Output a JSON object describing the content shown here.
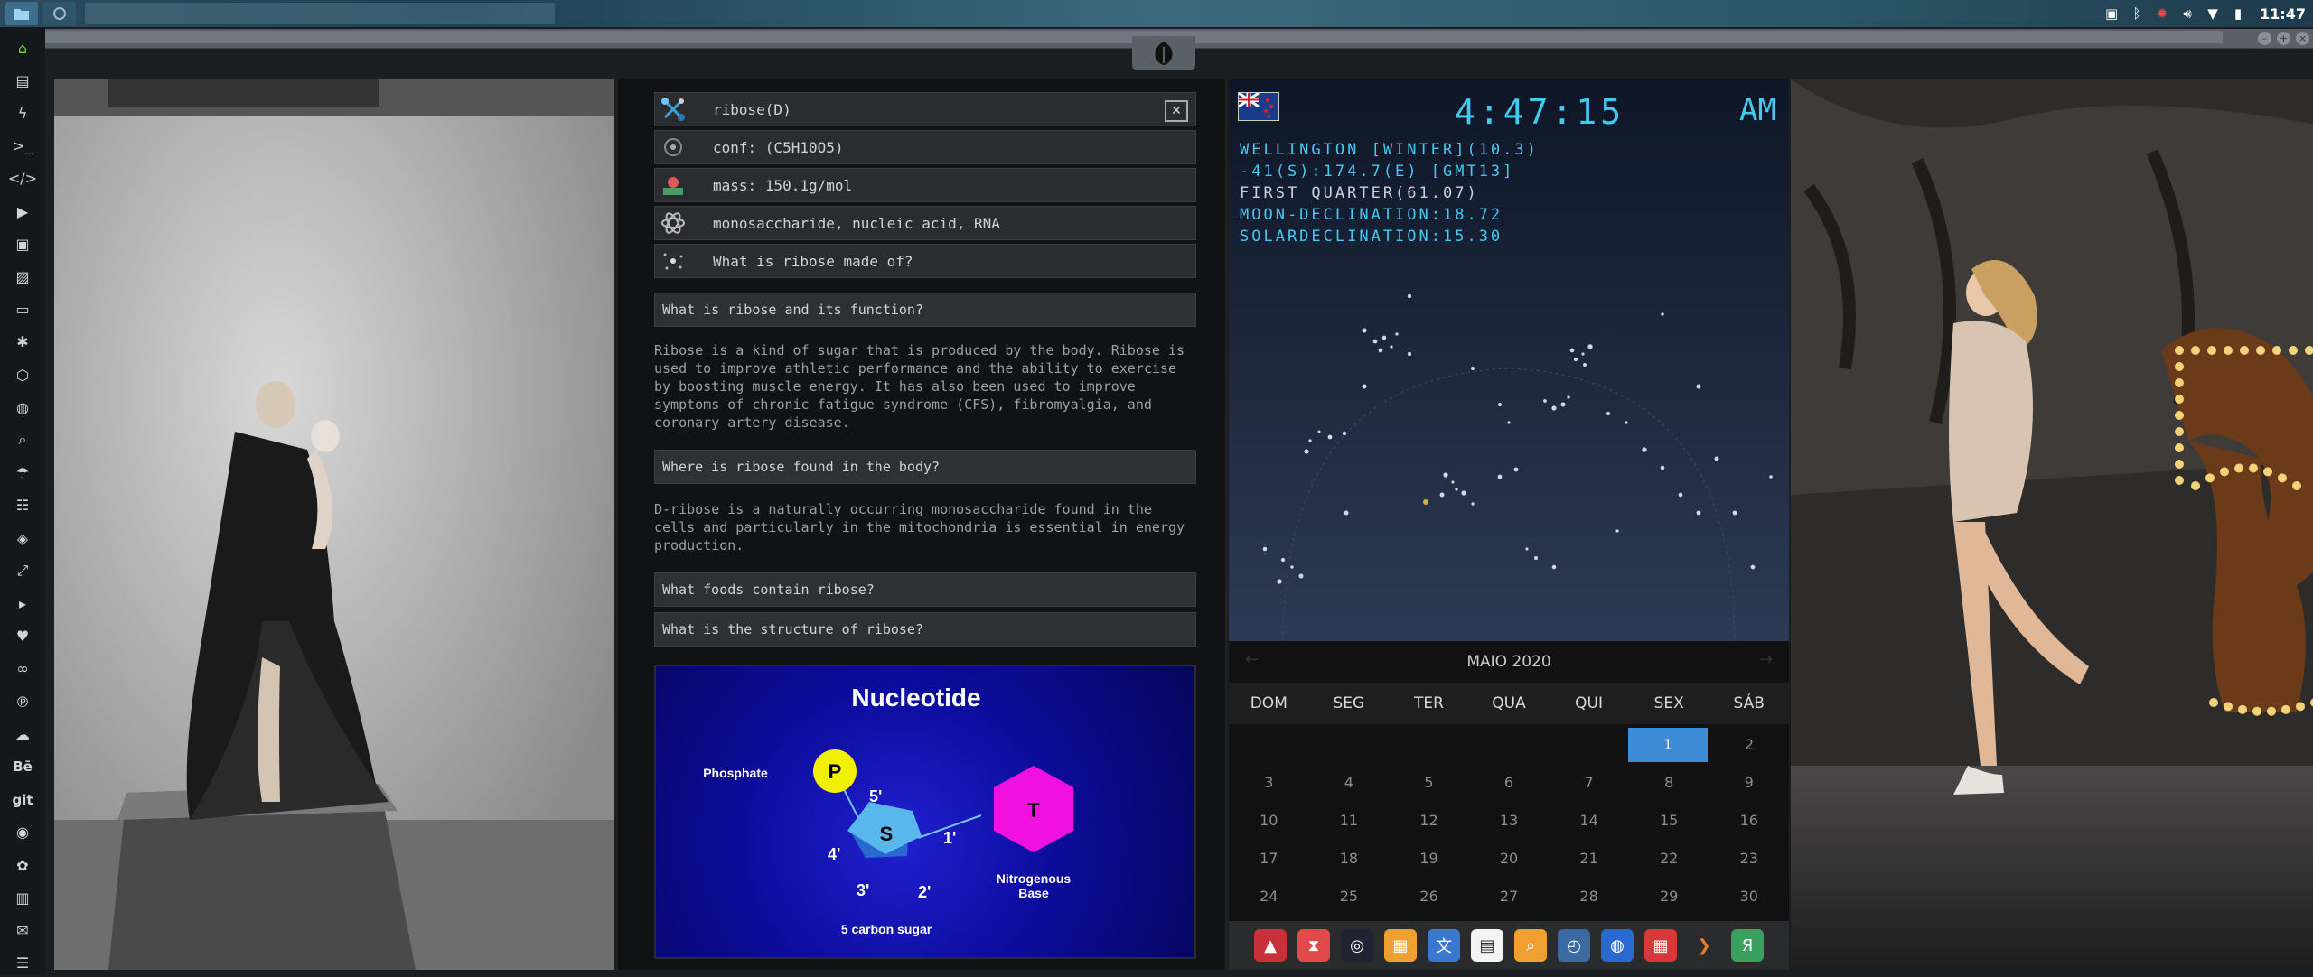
{
  "topbar": {
    "clock": "11:47",
    "tray_icons": [
      "image-icon",
      "bluetooth-icon",
      "bug-icon",
      "volume-icon",
      "wifi-icon",
      "battery-icon"
    ]
  },
  "sidebar": {
    "items": [
      "home-icon",
      "document-icon",
      "lightning-icon",
      "terminal-icon",
      "code-icon",
      "play-icon",
      "film-icon",
      "image-icon",
      "card-icon",
      "settings-icon",
      "shield-icon",
      "globe-icon",
      "search-icon",
      "umbrella-icon",
      "contacts-icon",
      "tag-icon",
      "expand-icon",
      "youtube-icon",
      "heart-icon",
      "link-icon",
      "pinterest-icon",
      "cloud-icon",
      "behance-icon",
      "git-icon",
      "github-icon",
      "fan-icon",
      "map-icon",
      "mail-icon",
      "storage-icon"
    ],
    "labels": {
      "behance": "Bē",
      "git": "git"
    }
  },
  "chem": {
    "rows": [
      {
        "label": "ribose(D)",
        "icon": "molecule-icon"
      },
      {
        "label": "conf: (C5H10O5)",
        "icon": "structure-icon"
      },
      {
        "label": "mass: 150.1g/mol",
        "icon": "scale-icon"
      },
      {
        "label": "monosaccharide, nucleic acid, RNA",
        "icon": "atom-icon"
      },
      {
        "label": "What is ribose made of?",
        "icon": "sparkle-icon"
      }
    ],
    "close": "✕"
  },
  "faq": {
    "q1": "What is ribose and its function?",
    "a1": "Ribose is a kind of sugar that is produced by the body. Ribose is used to improve athletic performance and the ability to exercise by boosting muscle energy. It has also been used to improve symptoms of chronic fatigue syndrome (CFS), fibromyalgia, and coronary artery disease.",
    "q2": "Where is ribose found in the body?",
    "a2": "D-ribose is a naturally occurring monosaccharide found in the cells and particularly in the mitochondria is essential in energy production.",
    "q3": "What foods contain ribose?",
    "q4": "What is the structure of ribose?"
  },
  "nucleotide": {
    "title": "Nucleotide",
    "phosphate_label": "Phosphate",
    "p": "P",
    "s": "S",
    "t": "T",
    "c5": "5'",
    "c4": "4'",
    "c3": "3'",
    "c2": "2'",
    "c1": "1'",
    "base_label_1": "Nitrogenous",
    "base_label_2": "Base",
    "sugar_label": "5 carbon sugar"
  },
  "clock_panel": {
    "time": "4:47:15",
    "ampm": "AM",
    "city": "WELLINGTON [WINTER](10.3)",
    "coords": "-41(S):174.7(E) [GMT13]",
    "moon_phase": "FIRST QUARTER(61.07)",
    "moon_decl": "MOON-DECLINATION:18.72",
    "solar_decl": "SOLARDECLINATION:15.30"
  },
  "calendar": {
    "month": "MAIO 2020",
    "days": [
      "DOM",
      "SEG",
      "TER",
      "QUA",
      "QUI",
      "SEX",
      "SÁB"
    ],
    "rows": [
      [
        "",
        "",
        "",
        "",
        "",
        "1",
        "2"
      ],
      [
        "3",
        "4",
        "5",
        "6",
        "7",
        "8",
        "9"
      ],
      [
        "10",
        "11",
        "12",
        "13",
        "14",
        "15",
        "16"
      ],
      [
        "17",
        "18",
        "19",
        "20",
        "21",
        "22",
        "23"
      ],
      [
        "24",
        "25",
        "26",
        "27",
        "28",
        "29",
        "30"
      ]
    ],
    "selected": "1"
  },
  "dock": {
    "icons": [
      "alert-icon",
      "hourglass-icon",
      "globe-dark-icon",
      "photos-icon",
      "translate-icon",
      "news-icon",
      "search-icon",
      "clock-icon",
      "web-icon",
      "calendar-icon",
      "arrow-icon",
      "yandex-icon"
    ]
  },
  "colors": {
    "accent": "#45c8f0",
    "selected": "#3d8ad6",
    "active_sidebar": "#6fd04a"
  }
}
